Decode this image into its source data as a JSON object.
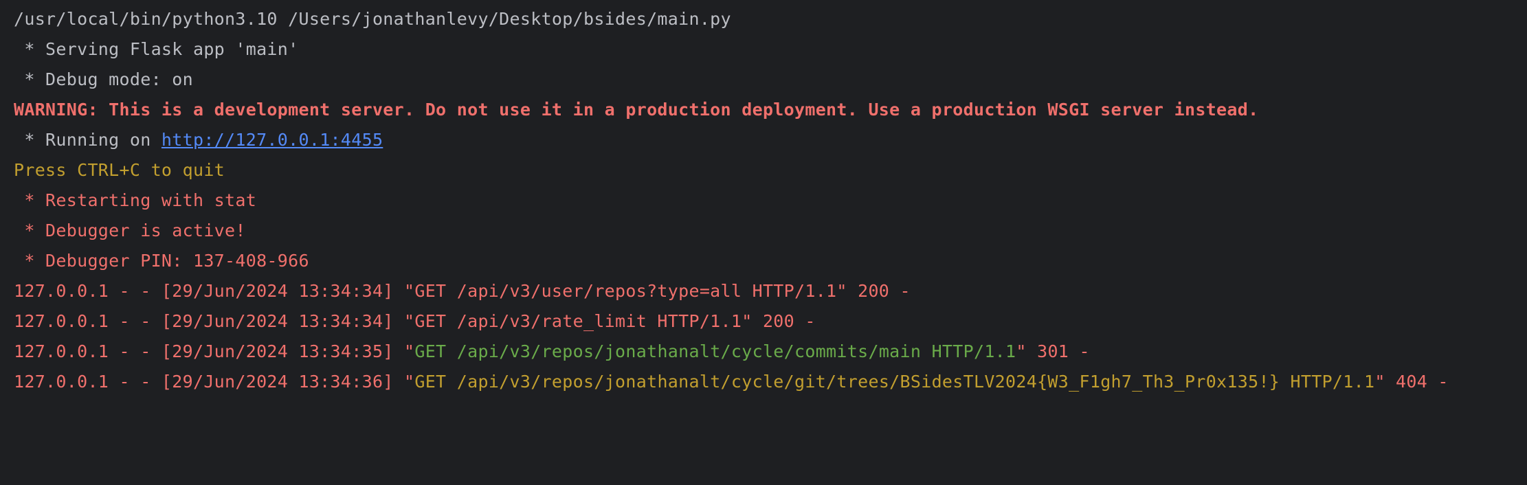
{
  "console": {
    "command_line": "/usr/local/bin/python3.10 /Users/jonathanlevy/Desktop/bsides/main.py",
    "serving": " * Serving Flask app 'main'",
    "debug_mode": " * Debug mode: on",
    "warning": "WARNING: This is a development server. Do not use it in a production deployment. Use a production WSGI server instead.",
    "running_prefix": " * Running on ",
    "running_url": "http://127.0.0.1:4455",
    "quit_hint": "Press CTRL+C to quit",
    "restarting": " * Restarting with stat",
    "debugger_active": " * Debugger is active!",
    "debugger_pin": " * Debugger PIN: 137-408-966",
    "requests": [
      {
        "prefix": "127.0.0.1 - - [29/Jun/2024 13:34:34] \"GET /api/v3/user/repos?type=all HTTP/1.1\" 200 -"
      },
      {
        "prefix": "127.0.0.1 - - [29/Jun/2024 13:34:34] \"GET /api/v3/rate_limit HTTP/1.1\" 200 -"
      },
      {
        "prefix": "127.0.0.1 - - [29/Jun/2024 13:34:35] \"",
        "request": "GET /api/v3/repos/jonathanalt/cycle/commits/main HTTP/1.1",
        "suffix": "\" 301 -"
      },
      {
        "prefix": "127.0.0.1 - - [29/Jun/2024 13:34:36] \"",
        "request": "GET /api/v3/repos/jonathanalt/cycle/git/trees/BSidesTLV2024{W3_F1gh7_Th3_Pr0x135!} HTTP/1.1",
        "suffix": "\" 404 -"
      }
    ]
  }
}
